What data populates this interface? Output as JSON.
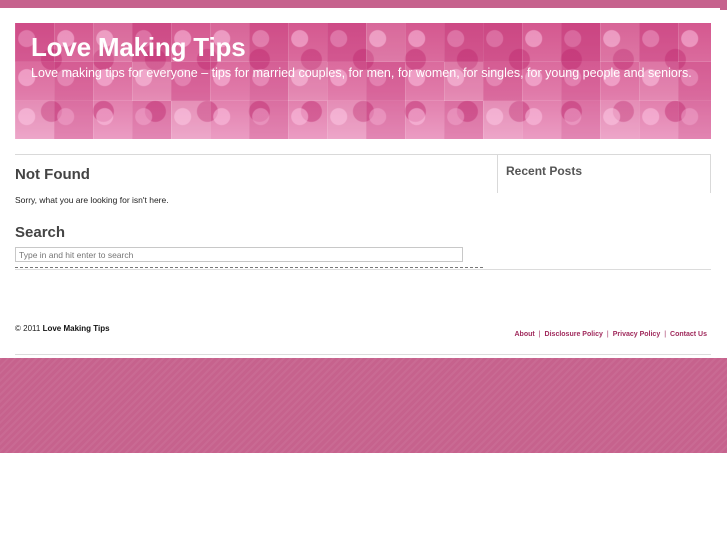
{
  "site": {
    "title": "Love Making Tips",
    "description": "Love making tips for everyone – tips for married couples, for men, for women, for singles, for young people and seniors."
  },
  "main": {
    "heading": "Not Found",
    "message": "Sorry, what you are looking for isn't here."
  },
  "search": {
    "heading": "Search",
    "placeholder": "Type in and hit enter to search"
  },
  "sidebar": {
    "recent_posts_title": "Recent Posts"
  },
  "footer": {
    "copyright_prefix": "© 2011",
    "site_name": "Love Making Tips",
    "links": [
      "About",
      "Disclosure Policy",
      "Privacy Policy",
      "Contact Us"
    ]
  },
  "colors": {
    "brand_pink": "#c6628d",
    "banner_pink": "#d86a9b",
    "link_color": "#a02a5c"
  }
}
